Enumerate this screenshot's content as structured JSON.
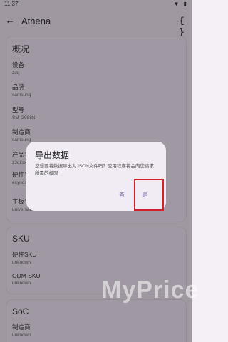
{
  "status": {
    "time": "11:37",
    "icons": "▼ ▮"
  },
  "appbar": {
    "back_icon": "←",
    "title": "Athena",
    "code_icon": "{ }"
  },
  "overview": {
    "title": "概况",
    "fields": [
      {
        "label": "设备",
        "value": "z3q"
      },
      {
        "label": "品牌",
        "value": "samsung"
      },
      {
        "label": "型号",
        "value": "SM-G988N"
      },
      {
        "label": "制造商",
        "value": "samsung"
      },
      {
        "label": "产品名",
        "value": "z3qksx"
      },
      {
        "label": "硬件名",
        "value": "exynos990"
      },
      {
        "label": "主板名",
        "value": "universal9830"
      }
    ]
  },
  "sku": {
    "title": "SKU",
    "fields": [
      {
        "label": "硬件SKU",
        "value": "unknown"
      },
      {
        "label": "ODM SKU",
        "value": "unknown"
      }
    ]
  },
  "soc": {
    "title": "SoC",
    "fields": [
      {
        "label": "制造商",
        "value": "unknown"
      }
    ]
  },
  "dialog": {
    "title": "导出数据",
    "message": "您想要将数据导出为JSON文件吗？应用程序将会向您请求所需的权限",
    "no_label": "否",
    "yes_label": "是"
  },
  "watermark": "MyPrice",
  "colors": {
    "highlight": "#d3202a",
    "accent": "#6b5a9a"
  }
}
